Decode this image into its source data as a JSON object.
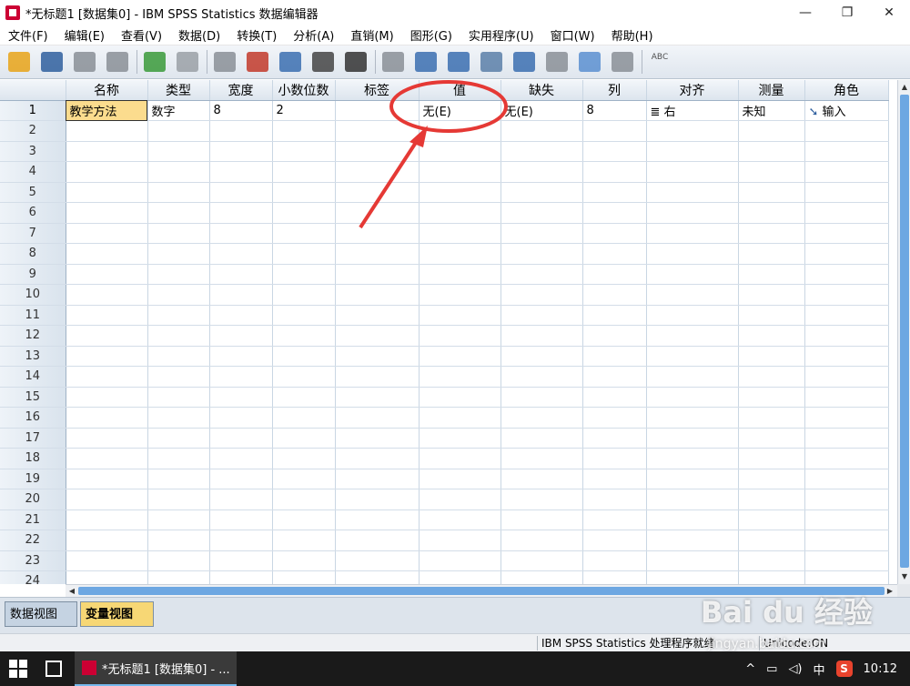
{
  "window": {
    "title": "*无标题1 [数据集0] - IBM SPSS Statistics 数据编辑器",
    "minimize": "—",
    "maximize": "❐",
    "close": "✕"
  },
  "menu": [
    "文件(F)",
    "编辑(E)",
    "查看(V)",
    "数据(D)",
    "转换(T)",
    "分析(A)",
    "直销(M)",
    "图形(G)",
    "实用程序(U)",
    "窗口(W)",
    "帮助(H)"
  ],
  "toolbar": {
    "icons": [
      {
        "name": "open-icon",
        "color": "#e8a317"
      },
      {
        "name": "save-icon",
        "color": "#2f5f9e"
      },
      {
        "name": "print-icon",
        "color": "#8a8f96"
      },
      {
        "name": "dialog-recall-icon",
        "color": "#8a8f96"
      },
      {
        "name": "undo-icon",
        "color": "#3a9a3a"
      },
      {
        "name": "redo-icon",
        "color": "#9aa0a6"
      },
      {
        "name": "goto-case-icon",
        "color": "#8a8f96"
      },
      {
        "name": "goto-variable-icon",
        "color": "#c23a2a"
      },
      {
        "name": "variables-icon",
        "color": "#3b6fb0"
      },
      {
        "name": "find-icon",
        "color": "#444444"
      },
      {
        "name": "binoculars-icon",
        "color": "#333333"
      },
      {
        "name": "insert-cases-icon",
        "color": "#8a8f96"
      },
      {
        "name": "insert-variable-icon",
        "color": "#3b6fb0"
      },
      {
        "name": "split-file-icon",
        "color": "#3b6fb0"
      },
      {
        "name": "weight-cases-icon",
        "color": "#5a7fa8"
      },
      {
        "name": "select-cases-icon",
        "color": "#3b6fb0"
      },
      {
        "name": "value-labels-icon",
        "color": "#8a8f96"
      },
      {
        "name": "use-sets-icon",
        "color": "#5a8fd0"
      },
      {
        "name": "show-all-icon",
        "color": "#8a8f96"
      },
      {
        "name": "spell-check-icon",
        "color": "#3a9a3a"
      }
    ],
    "spell_text": "ABC"
  },
  "columns": [
    "名称",
    "类型",
    "宽度",
    "小数位数",
    "标签",
    "值",
    "缺失",
    "列",
    "对齐",
    "测量",
    "角色"
  ],
  "rows": [
    {
      "num": "1",
      "cells": [
        "教学方法",
        "数字",
        "8",
        "2",
        "",
        "无(E)",
        "无(E)",
        "8",
        "右",
        "未知",
        "输入"
      ]
    }
  ],
  "row_numbers": [
    "2",
    "3",
    "4",
    "5",
    "6",
    "7",
    "8",
    "9",
    "10",
    "11",
    "12",
    "13",
    "14",
    "15",
    "16",
    "17",
    "18",
    "19",
    "20",
    "21",
    "22",
    "23",
    "24"
  ],
  "tabs": {
    "data_view": "数据视图(D)",
    "variable_view": "变量视图(V)"
  },
  "status": {
    "processor": "IBM SPSS Statistics 处理程序就绪",
    "unicode": "Unicode:ON"
  },
  "taskbar": {
    "task_title": "*无标题1 [数据集0] - ...",
    "ime": "中",
    "time": "10:12",
    "tray_arrow": "^"
  },
  "watermark": {
    "logo": "Bai du 经验",
    "url": "jingyan.baidu.com"
  },
  "annotation_color": "#e53935"
}
